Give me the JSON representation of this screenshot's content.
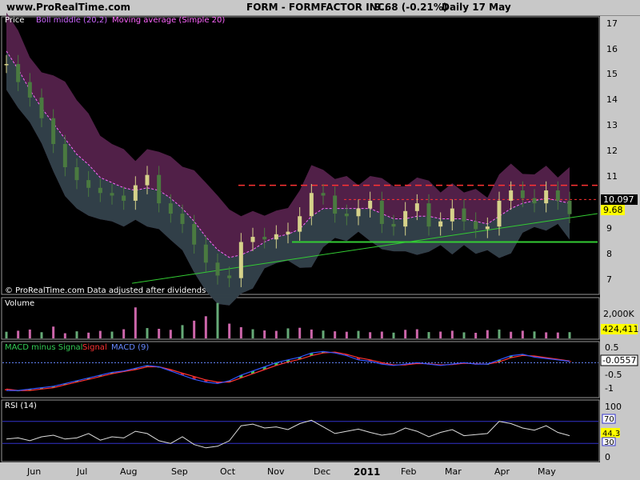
{
  "header": {
    "site": "www.ProRealTime.com",
    "title": "FORM - FORMFACTOR INC.",
    "price_change": "9.68 (-0.21%)",
    "period": "Daily  17 May"
  },
  "price_panel": {
    "legend_price": "Price",
    "legend_boll": "Boll middle (20,2)",
    "legend_ma": "Moving average (Simple 20)",
    "footer": "© ProRealTime.com  Data adjusted after dividends",
    "ticks": [
      "17",
      "16",
      "15",
      "14",
      "13",
      "12",
      "11",
      "10",
      "9",
      "8",
      "7"
    ],
    "last_price_badge": "9.68",
    "level_badge": "10.097"
  },
  "volume_panel": {
    "label": "Volume",
    "tick": "2,000K",
    "badge": "424,411"
  },
  "macd_panel": {
    "label_a": "MACD minus Signal",
    "label_b": "Signal",
    "label_c": "MACD (9)",
    "ticks": [
      "0.5",
      "0",
      "-0.5",
      "-1"
    ],
    "badge": "-0.0557"
  },
  "rsi_panel": {
    "label": "RSI (14)",
    "ticks": [
      "100",
      "50",
      "0"
    ],
    "badge_70": "70",
    "badge_value": "44.3",
    "badge_30": "30"
  },
  "x_axis": {
    "months": [
      "Jun",
      "Jul",
      "Aug",
      "Sep",
      "Oct",
      "Nov",
      "Dec",
      "2011",
      "Feb",
      "Mar",
      "Apr",
      "May"
    ]
  },
  "colors": {
    "background": "#000000",
    "band": "#5a2450",
    "band_lower": "#2e4248",
    "candle_up": "#d6d28a",
    "candle_down": "#4a7a40",
    "ma": "#ff66ff",
    "trend": "#33cc33",
    "resistance": "#ff3333",
    "volume_up": "#cc66aa",
    "volume_down": "#66aa77",
    "macd_hist": "#33cc55",
    "signal": "#ff3333",
    "macd": "#3355ff",
    "rsi_line": "#dddddd",
    "rsi_band": "#3333cc"
  },
  "chart_data": [
    {
      "type": "line",
      "title": "FORM - FORMFACTOR INC.",
      "series": [
        {
          "name": "Price",
          "values": [
            15.5,
            14.8,
            14.2,
            13.4,
            12.4,
            11.5,
            11.0,
            10.7,
            10.5,
            10.4,
            10.2,
            10.8,
            11.2,
            10.1,
            9.7,
            9.3,
            8.5,
            7.8,
            7.3,
            7.2,
            8.6,
            8.8,
            8.7,
            8.9,
            9.0,
            9.6,
            10.5,
            10.4,
            9.7,
            9.6,
            9.9,
            10.2,
            9.3,
            9.2,
            9.8,
            10.1,
            9.2,
            9.4,
            9.9,
            9.4,
            9.1,
            9.2,
            10.2,
            10.6,
            10.3,
            10.1,
            10.6,
            10.2,
            9.68
          ]
        },
        {
          "name": "Moving average (Simple 20)",
          "values": [
            16.0,
            15.3,
            14.5,
            13.8,
            13.2,
            12.6,
            12.0,
            11.6,
            11.1,
            10.9,
            10.7,
            10.6,
            10.7,
            10.6,
            10.3,
            9.9,
            9.4,
            8.8,
            8.3,
            8.0,
            8.1,
            8.3,
            8.6,
            8.8,
            8.9,
            9.1,
            9.6,
            9.9,
            9.9,
            9.9,
            9.9,
            9.9,
            9.7,
            9.5,
            9.5,
            9.6,
            9.6,
            9.5,
            9.5,
            9.5,
            9.4,
            9.3,
            9.6,
            9.9,
            10.1,
            10.2,
            10.3,
            10.2,
            10.1
          ]
        }
      ],
      "ylim": [
        6.6,
        17.3
      ],
      "support_level": 8.6,
      "resistance_level": 10.8,
      "trendline": {
        "from": 7.0,
        "to": 9.7
      }
    },
    {
      "type": "bar",
      "title": "Volume",
      "values": [
        450,
        520,
        600,
        420,
        800,
        350,
        480,
        390,
        510,
        460,
        620,
        2100,
        700,
        650,
        580,
        900,
        1200,
        1500,
        2400,
        1000,
        760,
        620,
        540,
        510,
        680,
        720,
        600,
        530,
        480,
        450,
        510,
        420,
        460,
        390,
        580,
        620,
        430,
        460,
        520,
        410,
        380,
        560,
        600,
        450,
        520,
        470,
        410,
        400,
        424
      ]
    },
    {
      "type": "line",
      "title": "MACD (9)",
      "ylim": [
        -1.2,
        0.7
      ],
      "series": [
        {
          "name": "MACD",
          "values": [
            -1.0,
            -1.0,
            -0.95,
            -0.9,
            -0.85,
            -0.75,
            -0.65,
            -0.55,
            -0.45,
            -0.35,
            -0.3,
            -0.2,
            -0.1,
            -0.15,
            -0.3,
            -0.45,
            -0.6,
            -0.7,
            -0.75,
            -0.65,
            -0.45,
            -0.3,
            -0.15,
            0.0,
            0.1,
            0.2,
            0.35,
            0.4,
            0.35,
            0.25,
            0.1,
            0.05,
            -0.05,
            -0.1,
            -0.05,
            0.0,
            -0.05,
            -0.1,
            -0.05,
            0.0,
            -0.05,
            -0.05,
            0.1,
            0.25,
            0.3,
            0.2,
            0.15,
            0.1,
            0.05
          ]
        },
        {
          "name": "Signal",
          "values": [
            -0.95,
            -1.0,
            -1.0,
            -0.95,
            -0.9,
            -0.8,
            -0.7,
            -0.6,
            -0.5,
            -0.4,
            -0.32,
            -0.25,
            -0.15,
            -0.15,
            -0.25,
            -0.38,
            -0.5,
            -0.62,
            -0.7,
            -0.7,
            -0.55,
            -0.4,
            -0.25,
            -0.1,
            0.02,
            0.12,
            0.25,
            0.35,
            0.38,
            0.3,
            0.18,
            0.1,
            0.0,
            -0.08,
            -0.08,
            -0.03,
            -0.04,
            -0.08,
            -0.07,
            -0.02,
            -0.04,
            -0.05,
            0.03,
            0.18,
            0.26,
            0.24,
            0.18,
            0.12,
            0.06
          ]
        }
      ]
    },
    {
      "type": "line",
      "title": "RSI (14)",
      "ylim": [
        0,
        100
      ],
      "series": [
        {
          "name": "RSI (14)",
          "values": [
            38,
            40,
            35,
            42,
            45,
            38,
            40,
            48,
            36,
            42,
            40,
            52,
            48,
            35,
            30,
            42,
            28,
            22,
            25,
            35,
            62,
            65,
            58,
            60,
            55,
            66,
            72,
            60,
            48,
            52,
            56,
            50,
            45,
            48,
            58,
            52,
            42,
            50,
            55,
            44,
            46,
            48,
            70,
            66,
            58,
            54,
            62,
            50,
            44
          ]
        }
      ]
    }
  ]
}
